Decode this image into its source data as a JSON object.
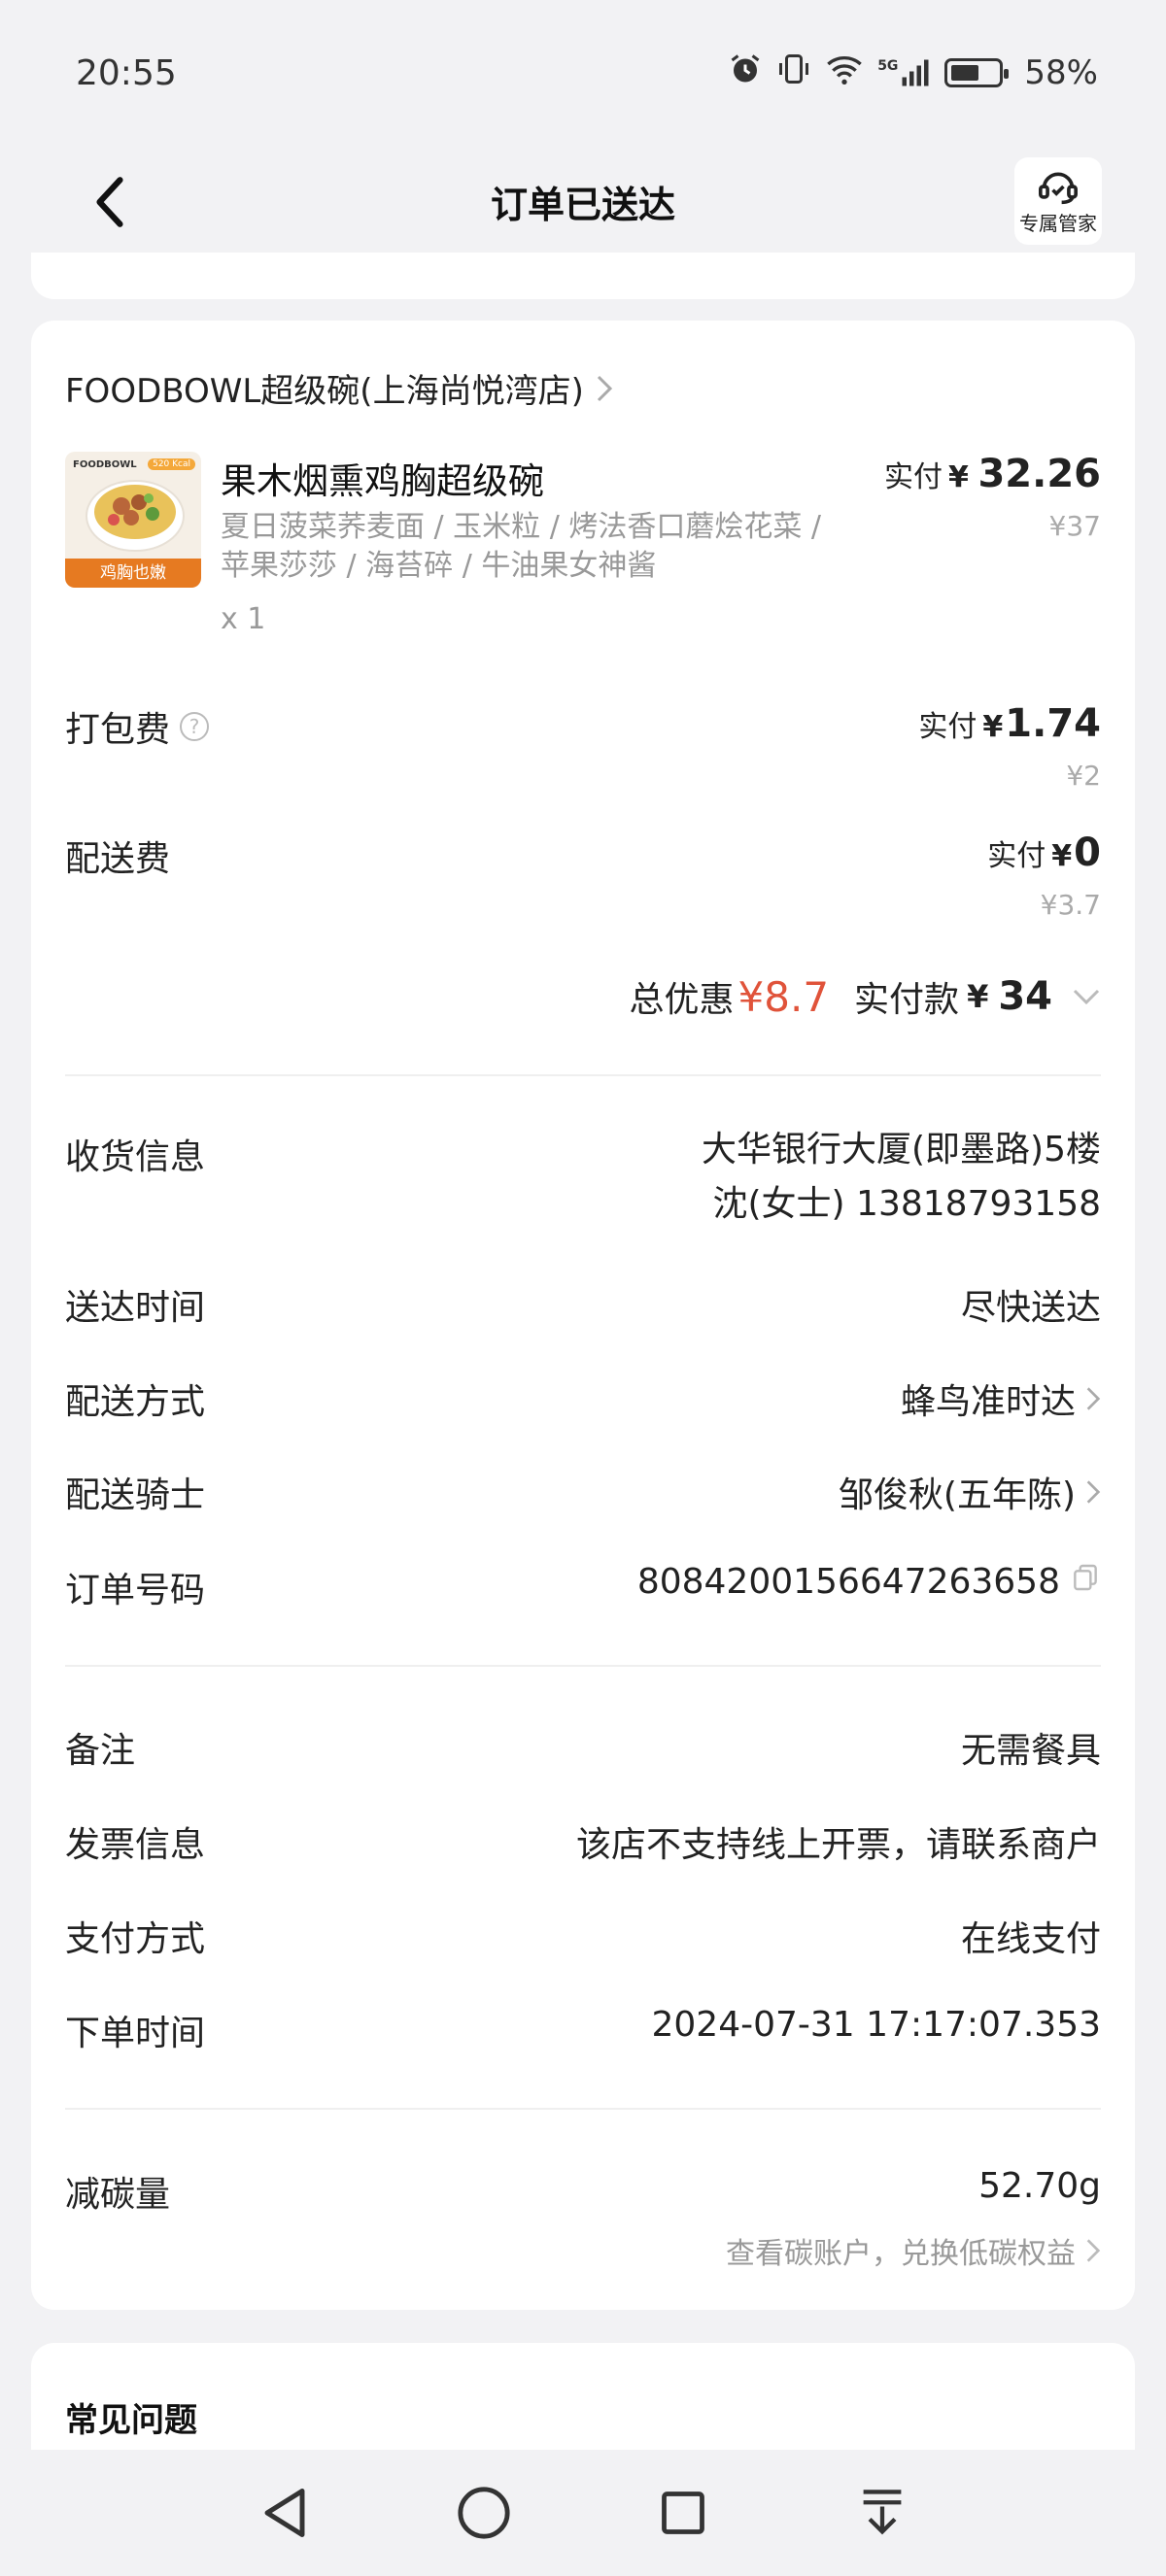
{
  "status_bar": {
    "time": "20:55",
    "network": "5G",
    "battery": "58%"
  },
  "header": {
    "title": "订单已送达",
    "manager_label": "专属管家"
  },
  "shop": {
    "name": "FOODBOWL超级碗(上海尚悦湾店)"
  },
  "product": {
    "thumb_brand": "FOODBOWL",
    "thumb_kcal": "520 Kcal",
    "thumb_banner": "鸡胸也嫩",
    "name": "果木烟熏鸡胸超级碗",
    "description": "夏日菠菜荞麦面 / 玉米粒 / 烤法香口蘑烩花菜 / 苹果莎莎 / 海苔碎 / 牛油果女神酱",
    "quantity": "x 1",
    "paid_label": "实付",
    "currency": "¥",
    "paid_amount": "32.26",
    "original_price": "¥37"
  },
  "fees": {
    "packing_label": "打包费",
    "packing_paid_label": "实付",
    "packing_currency": "¥",
    "packing_amount": "1.74",
    "packing_original": "¥2",
    "delivery_label": "配送费",
    "delivery_paid_label": "实付",
    "delivery_currency": "¥",
    "delivery_amount": "0",
    "delivery_original": "¥3.7"
  },
  "summary": {
    "discount_label": "总优惠",
    "discount_value": "¥8.7",
    "total_label": "实付款",
    "total_currency": "¥",
    "total_amount": "34"
  },
  "info": {
    "receiver_label": "收货信息",
    "receiver_address": "大华银行大厦(即墨路)5楼",
    "receiver_contact": "沈(女士) 13818793158",
    "time_label": "送达时间",
    "time_value": "尽快送达",
    "method_label": "配送方式",
    "method_value": "蜂鸟准时达",
    "rider_label": "配送骑士",
    "rider_value": "邹俊秋(五年陈)",
    "order_no_label": "订单号码",
    "order_no_value": "8084200156647263658"
  },
  "extra": {
    "remark_label": "备注",
    "remark_value": "无需餐具",
    "invoice_label": "发票信息",
    "invoice_value": "该店不支持线上开票，请联系商户",
    "payment_label": "支付方式",
    "payment_value": "在线支付",
    "order_time_label": "下单时间",
    "order_time_value": "2024-07-31 17:17:07.353"
  },
  "carbon": {
    "label": "减碳量",
    "value": "52.70g",
    "link": "查看碳账户，兑换低碳权益"
  },
  "faq": {
    "title": "常见问题"
  },
  "colors": {
    "accent_red": "#e0533a",
    "background": "#f2f2f4",
    "card": "#ffffff",
    "muted": "#999999"
  }
}
